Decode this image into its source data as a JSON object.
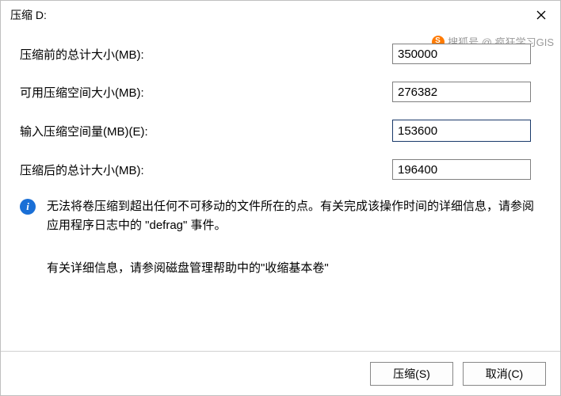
{
  "title": "压缩 D:",
  "fields": {
    "total_before": {
      "label": "压缩前的总计大小(MB):",
      "value": "350000"
    },
    "available": {
      "label": "可用压缩空间大小(MB):",
      "value": "276382"
    },
    "input_amount": {
      "label": "输入压缩空间量(MB)(E):",
      "value": "153600"
    },
    "total_after": {
      "label": "压缩后的总计大小(MB):",
      "value": "196400"
    }
  },
  "info_text": "无法将卷压缩到超出任何不可移动的文件所在的点。有关完成该操作时间的详细信息，请参阅应用程序日志中的 \"defrag\" 事件。",
  "detail_text": "有关详细信息，请参阅磁盘管理帮助中的\"收缩基本卷\"",
  "buttons": {
    "shrink": "压缩(S)",
    "cancel": "取消(C)"
  },
  "watermark": "搜狐号 @ 疯狂学习GIS"
}
